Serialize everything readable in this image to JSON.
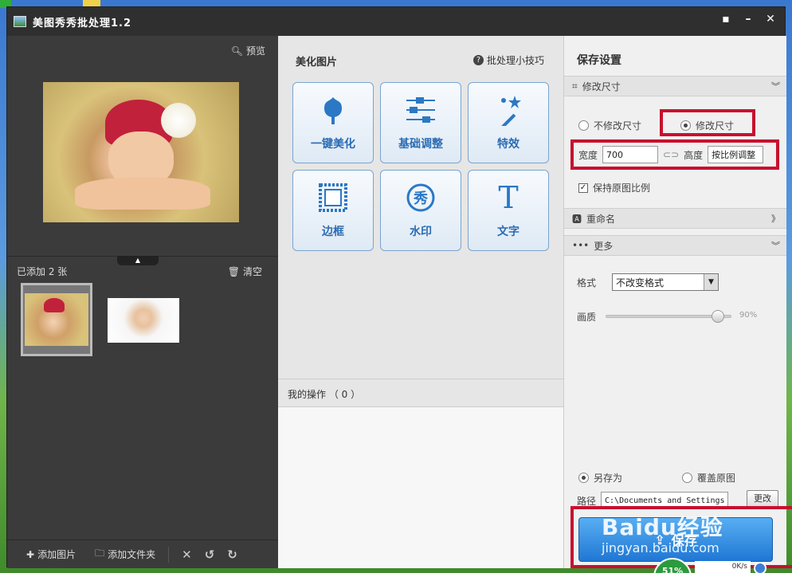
{
  "window": {
    "title": "美图秀秀批处理1.2"
  },
  "left": {
    "preview_label": "预览",
    "count_label": "已添加 2 张",
    "clear_label": "清空",
    "add_image": "添加图片",
    "add_folder": "添加文件夹"
  },
  "middle": {
    "header": "美化图片",
    "tips": "批处理小技巧",
    "tools": [
      {
        "label": "一键美化",
        "icon": "tulip-icon"
      },
      {
        "label": "基础调整",
        "icon": "sliders-icon"
      },
      {
        "label": "特效",
        "icon": "magic-wand-icon"
      },
      {
        "label": "边框",
        "icon": "frame-icon"
      },
      {
        "label": "水印",
        "icon": "watermark-xiu-icon"
      },
      {
        "label": "文字",
        "icon": "text-t-icon"
      }
    ],
    "watermark_glyph": "秀",
    "text_glyph": "T",
    "ops_label": "我的操作 （ 0 ）"
  },
  "right": {
    "title": "保存设置",
    "resize_section": "修改尺寸",
    "no_resize": "不修改尺寸",
    "resize": "修改尺寸",
    "width_label": "宽度",
    "width_value": "700",
    "height_label": "高度",
    "height_value": "按比例调整",
    "keep_ratio": "保持原图比例",
    "rename_section": "重命名",
    "more_section": "更多",
    "format_label": "格式",
    "format_value": "不改变格式",
    "quality_label": "画质",
    "quality_percent": 90,
    "quality_text": "90%",
    "save_as": "另存为",
    "overwrite": "覆盖原图",
    "path_label": "路径",
    "path_value": "C:\\Documents and Settings\\",
    "change_btn": "更改",
    "save_btn": "保存"
  },
  "overlay": {
    "wm_logo": "Baidu经验",
    "wm_url": "jingyan.baidu.com",
    "cpu": "51%",
    "net": "0K/s"
  }
}
